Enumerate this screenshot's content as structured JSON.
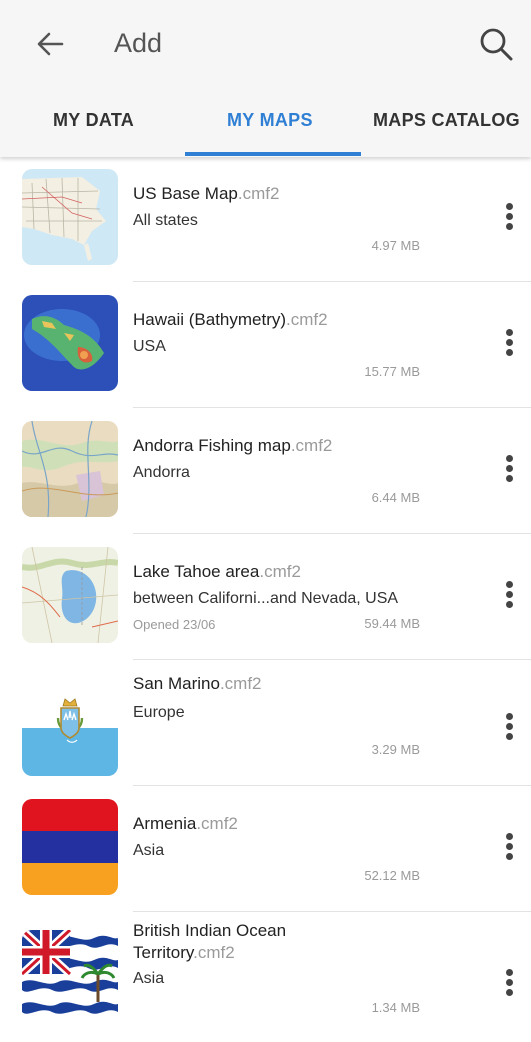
{
  "header": {
    "title": "Add",
    "back_icon": "arrow-left-icon",
    "search_icon": "search-icon"
  },
  "tabs": [
    {
      "label": "MY DATA",
      "active": false
    },
    {
      "label": "MY MAPS",
      "active": true
    },
    {
      "label": "MAPS CATALOG",
      "active": false
    }
  ],
  "colors": {
    "accent": "#2f7fd4"
  },
  "maps": [
    {
      "name": "US Base Map",
      "ext": ".cmf2",
      "subtitle": "All states",
      "opened": "",
      "size": "4.97 MB",
      "thumb": "us-base-map-thumbnail"
    },
    {
      "name": "Hawaii (Bathymetry)",
      "ext": ".cmf2",
      "subtitle": "USA",
      "opened": "",
      "size": "15.77 MB",
      "thumb": "hawaii-bathymetry-thumbnail"
    },
    {
      "name": "Andorra Fishing map",
      "ext": ".cmf2",
      "subtitle": "Andorra",
      "opened": "",
      "size": "6.44 MB",
      "thumb": "andorra-map-thumbnail"
    },
    {
      "name": "Lake Tahoe area",
      "ext": ".cmf2",
      "subtitle": "between Californi...and Nevada, USA",
      "opened": "Opened 23/06",
      "size": "59.44 MB",
      "thumb": "lake-tahoe-map-thumbnail"
    },
    {
      "name": "San Marino",
      "ext": ".cmf2",
      "subtitle": "Europe",
      "opened": "",
      "size": "3.29 MB",
      "thumb": "san-marino-flag"
    },
    {
      "name": "Armenia",
      "ext": ".cmf2",
      "subtitle": "Asia",
      "opened": "",
      "size": "52.12 MB",
      "thumb": "armenia-flag"
    },
    {
      "name_line1": "British Indian Ocean",
      "name_line2": "Territory",
      "ext": ".cmf2",
      "subtitle": "Asia",
      "opened": "",
      "size": "1.34 MB",
      "thumb": "british-indian-ocean-territory-flag"
    }
  ]
}
